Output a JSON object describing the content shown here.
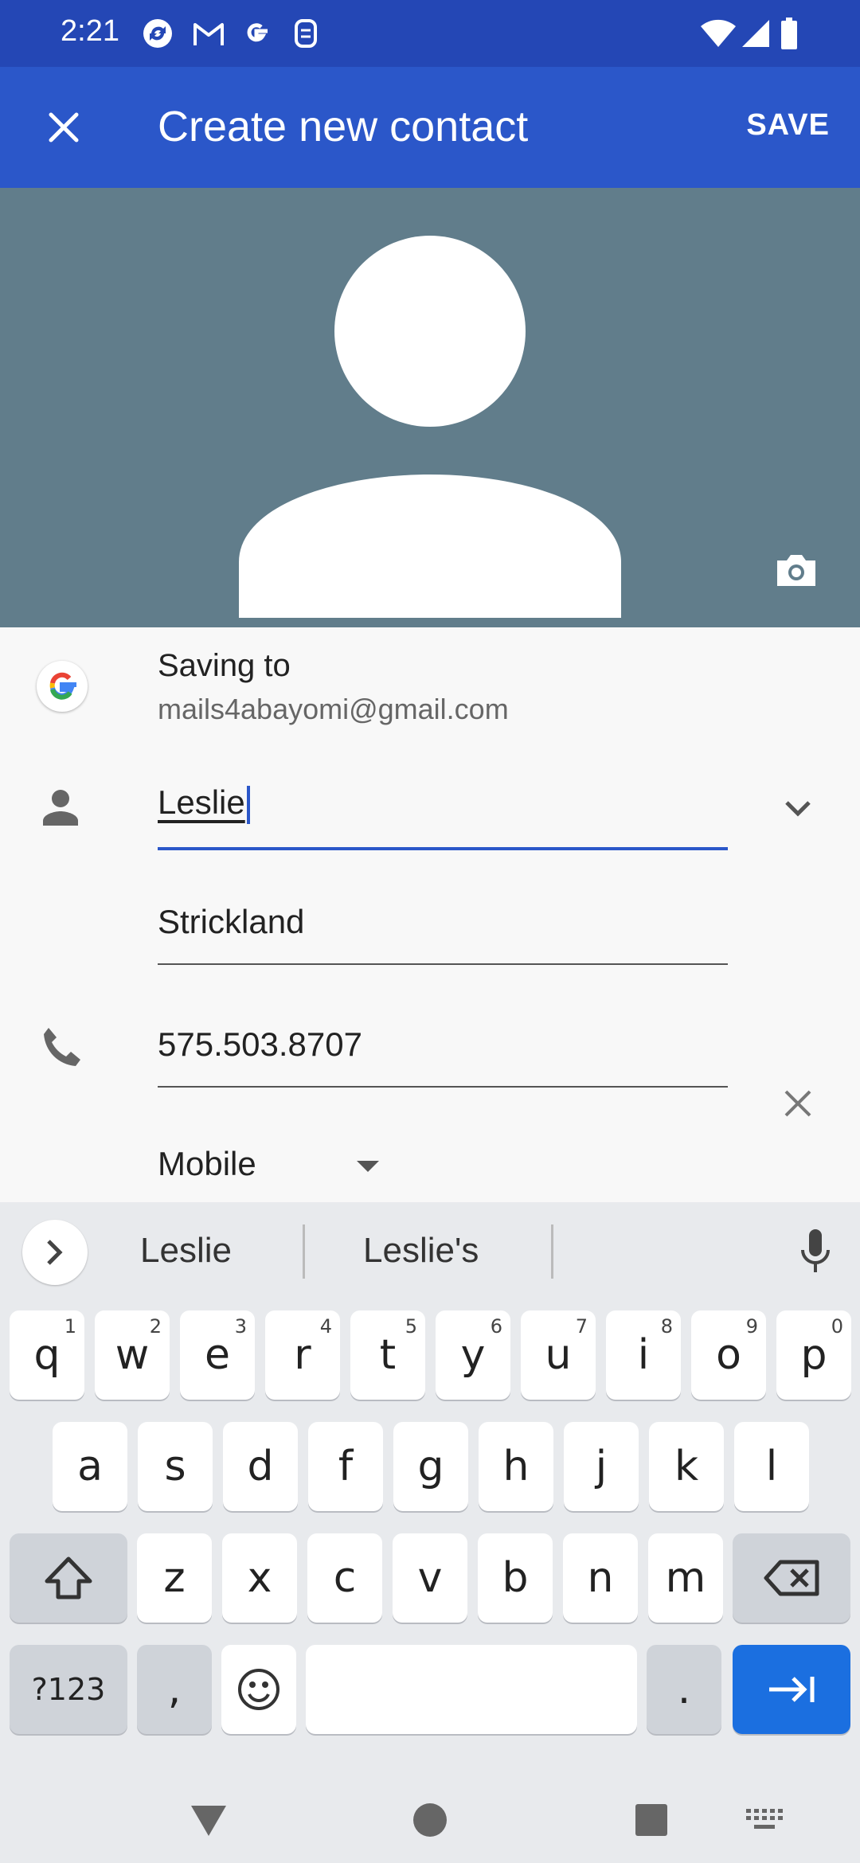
{
  "status_bar": {
    "time": "2:21",
    "notification_icons": [
      "sync-icon",
      "gmail-icon",
      "google-icon",
      "messages-icon"
    ],
    "system_icons": [
      "wifi-icon",
      "signal-icon",
      "battery-icon"
    ]
  },
  "app_bar": {
    "title": "Create new contact",
    "save_label": "SAVE",
    "close_icon": "close-icon"
  },
  "account": {
    "saving_label": "Saving to",
    "email": "mails4abayomi@gmail.com",
    "icon": "google-icon"
  },
  "form": {
    "first_name": "Leslie",
    "last_name": "Strickland",
    "phone": "575.503.8707",
    "phone_type": "Mobile"
  },
  "keyboard": {
    "suggestions": [
      "Leslie",
      "Leslie's"
    ],
    "row1": [
      {
        "k": "q",
        "h": "1"
      },
      {
        "k": "w",
        "h": "2"
      },
      {
        "k": "e",
        "h": "3"
      },
      {
        "k": "r",
        "h": "4"
      },
      {
        "k": "t",
        "h": "5"
      },
      {
        "k": "y",
        "h": "6"
      },
      {
        "k": "u",
        "h": "7"
      },
      {
        "k": "i",
        "h": "8"
      },
      {
        "k": "o",
        "h": "9"
      },
      {
        "k": "p",
        "h": "0"
      }
    ],
    "row2": [
      "a",
      "s",
      "d",
      "f",
      "g",
      "h",
      "j",
      "k",
      "l"
    ],
    "row3": [
      "z",
      "x",
      "c",
      "v",
      "b",
      "n",
      "m"
    ],
    "symbols_label": "?123",
    "comma_label": ",",
    "period_label": "."
  },
  "colors": {
    "status_bar": "#2447b5",
    "app_bar": "#2b57c9",
    "photo_bg": "#617d8b",
    "accent": "#2b57c9",
    "enter_key": "#1b6fe0"
  }
}
